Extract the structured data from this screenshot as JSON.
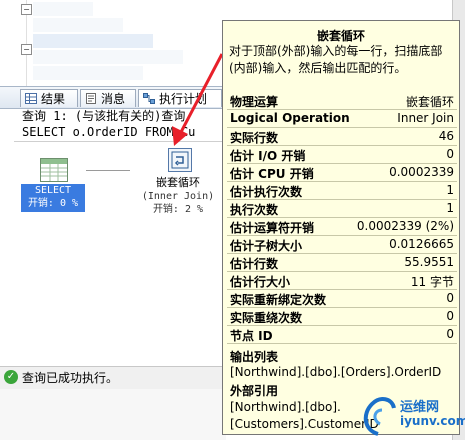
{
  "tabs": [
    {
      "label": "结果",
      "icon": "results-grid-icon"
    },
    {
      "label": "消息",
      "icon": "messages-icon"
    },
    {
      "label": "执行计划",
      "icon": "execution-plan-icon"
    }
  ],
  "query": {
    "line1": "查询 1: (与该批有关的)查询",
    "line2": "SELECT o.OrderID FROM Cu"
  },
  "plan": {
    "select_node": {
      "label": "SELECT",
      "cost": "开销: 0 %"
    },
    "nested_loops_node": {
      "label": "嵌套循环",
      "sublabel": "(Inner Join)",
      "cost": "开销: 2 %"
    }
  },
  "status": {
    "text": "查询已成功执行。"
  },
  "tooltip": {
    "title": "嵌套循环",
    "description": "对于顶部(外部)输入的每一行，扫描底部(内部)输入，然后输出匹配的行。",
    "rows": [
      {
        "key": "物理运算",
        "value": "嵌套循环"
      },
      {
        "key": "Logical Operation",
        "value": "Inner Join"
      },
      {
        "key": "实际行数",
        "value": "46"
      },
      {
        "key": "估计 I/O 开销",
        "value": "0"
      },
      {
        "key": "估计 CPU 开销",
        "value": "0.0002339"
      },
      {
        "key": "估计执行次数",
        "value": "1"
      },
      {
        "key": "执行次数",
        "value": "1"
      },
      {
        "key": "估计运算符开销",
        "value": "0.0002339 (2%)"
      },
      {
        "key": "估计子树大小",
        "value": "0.0126665"
      },
      {
        "key": "估计行数",
        "value": "55.9551"
      },
      {
        "key": "估计行大小",
        "value": "11 字节"
      },
      {
        "key": "实际重新绑定次数",
        "value": "0"
      },
      {
        "key": "实际重绕次数",
        "value": "0"
      },
      {
        "key": "节点 ID",
        "value": "0"
      }
    ],
    "output_list_header": "输出列表",
    "output_list": "[Northwind].[dbo].[Orders].OrderID",
    "outer_refs_header": "外部引用",
    "outer_refs": "[Northwind].[dbo].[Customers].CustomerID"
  },
  "watermark": {
    "cn": "运维网",
    "en": "iyunv.com"
  },
  "colors": {
    "tooltip_bg": "#ffffe1",
    "select_highlight": "#3a7be0",
    "annotation_arrow": "#e8202a",
    "watermark": "#1a6fc9"
  }
}
